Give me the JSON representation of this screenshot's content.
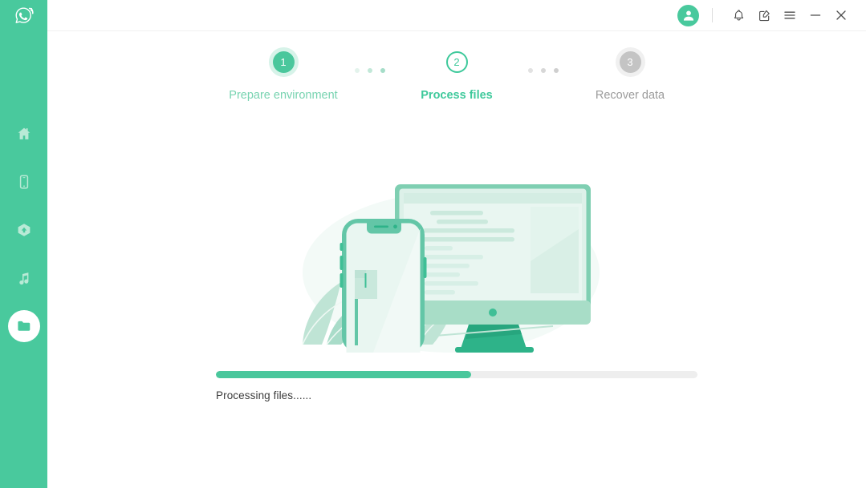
{
  "colors": {
    "brand_green": "#49c99d",
    "step_done_green": "#4ac79c",
    "step_current_green": "#3ec99b",
    "step_label_done": "#77d3b0",
    "step_todo_gray": "#c4c4c4",
    "step_label_todo": "#9b9b9b",
    "progress_track": "#eeeeee",
    "titlebar_divider": "#f0f0f0",
    "illustration_light": "#e6f4ee",
    "illustration_mid": "#a8ddc7",
    "illustration_dark": "#2eb389"
  },
  "sidebar": {
    "logo_name": "whatsapp-recovery-logo",
    "items": [
      {
        "name": "home",
        "icon": "home-icon",
        "active": false
      },
      {
        "name": "device",
        "icon": "phone-icon",
        "active": false
      },
      {
        "name": "backup",
        "icon": "cloud-backup-icon",
        "active": false
      },
      {
        "name": "media",
        "icon": "music-note-icon",
        "active": false
      },
      {
        "name": "files",
        "icon": "folder-icon",
        "active": true
      }
    ]
  },
  "titlebar": {
    "avatar_icon": "user-avatar-icon",
    "buttons": [
      {
        "name": "notifications",
        "icon": "bell-icon"
      },
      {
        "name": "feedback",
        "icon": "edit-square-icon"
      },
      {
        "name": "menu",
        "icon": "hamburger-menu-icon"
      },
      {
        "name": "minimize",
        "icon": "minimize-icon"
      },
      {
        "name": "close",
        "icon": "close-icon"
      }
    ]
  },
  "steps": [
    {
      "number": "1",
      "label": "Prepare environment",
      "state": "done"
    },
    {
      "number": "2",
      "label": "Process files",
      "state": "current"
    },
    {
      "number": "3",
      "label": "Recover data",
      "state": "todo"
    }
  ],
  "connectors": [
    {
      "name": "connector-1-2",
      "state": "done",
      "dots": [
        "#e3f3ec",
        "#c2e8d8",
        "#a5ddc8"
      ]
    },
    {
      "name": "connector-2-3",
      "state": "todo",
      "dots": [
        "#e2e2e2",
        "#d7d7d7",
        "#cfcfcf"
      ]
    }
  ],
  "illustration": {
    "name": "device-to-computer-transfer-illustration",
    "alt": "Smartphone in front of a desktop monitor showing lines of text, with leaves"
  },
  "progress": {
    "label": "Processing files......",
    "percent": 53,
    "percent_text": "53%"
  }
}
